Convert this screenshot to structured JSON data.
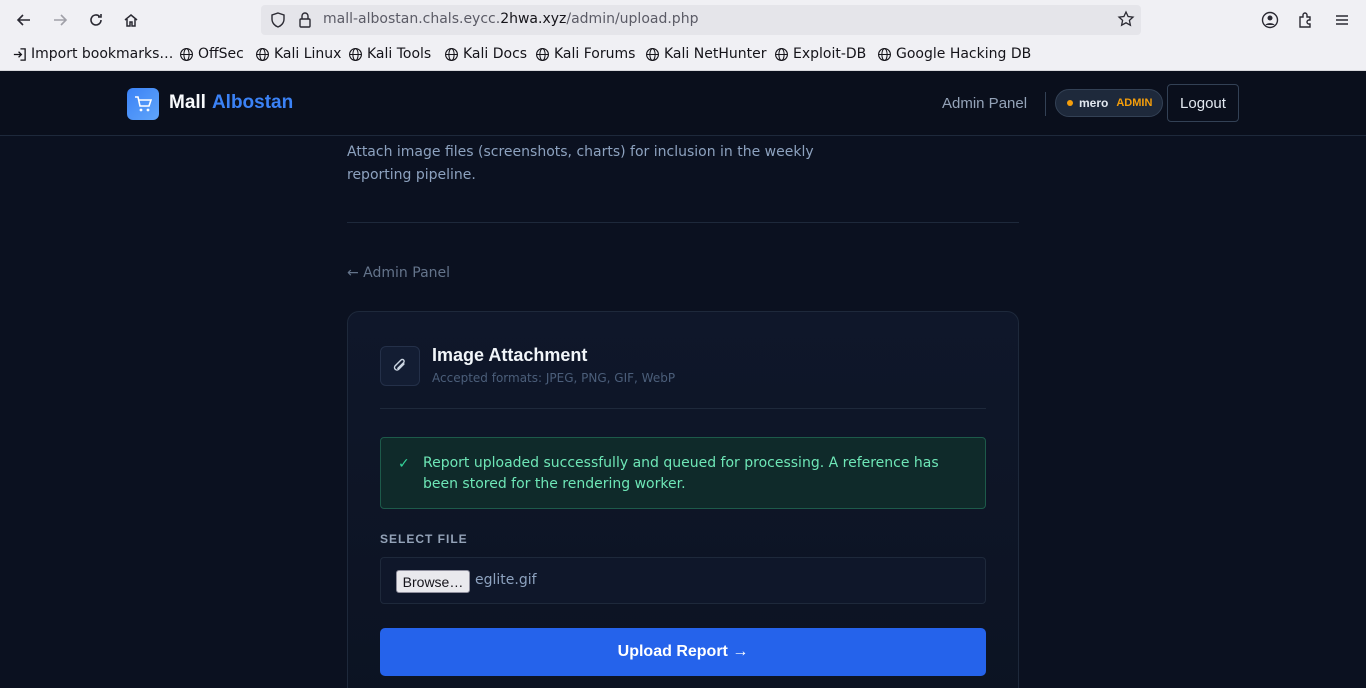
{
  "browser": {
    "url_prefix": "mall-albostan.chals.eycc.",
    "url_domain": "2hwa.xyz",
    "url_path": "/admin/upload.php"
  },
  "bookmarks": [
    {
      "label": "Import bookmarks…",
      "icon": "import-icon"
    },
    {
      "label": "OffSec",
      "icon": "globe-icon"
    },
    {
      "label": "Kali Linux",
      "icon": "globe-icon"
    },
    {
      "label": "Kali Tools",
      "icon": "globe-icon"
    },
    {
      "label": "Kali Docs",
      "icon": "globe-icon"
    },
    {
      "label": "Kali Forums",
      "icon": "globe-icon"
    },
    {
      "label": "Kali NetHunter",
      "icon": "globe-icon"
    },
    {
      "label": "Exploit-DB",
      "icon": "globe-icon"
    },
    {
      "label": "Google Hacking DB",
      "icon": "globe-icon"
    }
  ],
  "header": {
    "logo_word1": "Mall",
    "logo_word2": "Albostan",
    "admin_link": "Admin Panel",
    "user_name": "mero",
    "user_role": "ADMIN",
    "logout_label": "Logout"
  },
  "main": {
    "intro": "Attach image files (screenshots, charts) for inclusion in the weekly reporting pipeline.",
    "back_link": "← Admin Panel"
  },
  "card": {
    "title": "Image Attachment",
    "subtitle": "Accepted formats: JPEG, PNG, GIF, WebP",
    "alert_check": "✓",
    "alert_message": "Report uploaded successfully and queued for processing. A reference has been stored for the rendering worker.",
    "field_label": "SELECT FILE",
    "browse_label": "Browse…",
    "file_name": "eglite.gif",
    "upload_label": "Upload Report →"
  },
  "colors": {
    "accent": "#2563eb",
    "success": "#34d399",
    "role_badge": "#f59e0b"
  }
}
